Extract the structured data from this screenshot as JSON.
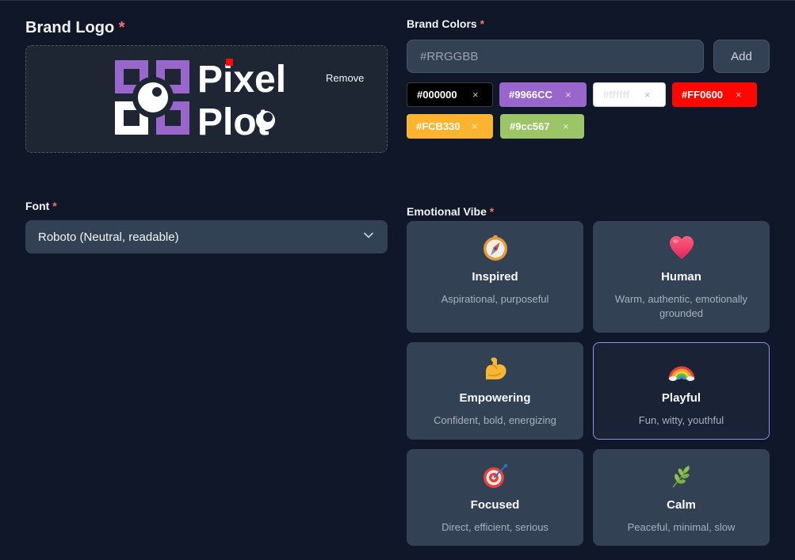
{
  "brand_logo": {
    "label": "Brand Logo",
    "required_mark": "*",
    "remove_label": "Remove",
    "logo_text_line1": "Pixel",
    "logo_text_line2": "Plot"
  },
  "brand_colors": {
    "label": "Brand Colors",
    "required_mark": "*",
    "input_placeholder": "#RRGGBB",
    "add_label": "Add",
    "remove_glyph": "×",
    "chips": [
      {
        "value": "#000000",
        "bg": "#000000",
        "fg": "#ffffff"
      },
      {
        "value": "#9966CC",
        "bg": "#9966cc",
        "fg": "#ffffff"
      },
      {
        "value": "#ffffff",
        "bg": "#ffffff",
        "fg": "#e8e8e8"
      },
      {
        "value": "#FF0600",
        "bg": "#ff0600",
        "fg": "#ffffff"
      },
      {
        "value": "#FCB330",
        "bg": "#fcb330",
        "fg": "#ffffff"
      },
      {
        "value": "#9cc567",
        "bg": "#9cc567",
        "fg": "#ffffff"
      }
    ]
  },
  "font": {
    "label": "Font",
    "required_mark": "*",
    "selected": "Roboto (Neutral, readable)"
  },
  "emotional_vibe": {
    "label": "Emotional Vibe",
    "required_mark": "*",
    "selected": "Playful",
    "options": [
      {
        "title": "Inspired",
        "desc": "Aspirational, purposeful",
        "icon": "compass-icon"
      },
      {
        "title": "Human",
        "desc": "Warm, authentic, emotionally grounded",
        "icon": "heart-icon"
      },
      {
        "title": "Empowering",
        "desc": "Confident, bold, energizing",
        "icon": "flexed-biceps-icon"
      },
      {
        "title": "Playful",
        "desc": "Fun, witty, youthful",
        "icon": "rainbow-icon"
      },
      {
        "title": "Focused",
        "desc": "Direct, efficient, serious",
        "icon": "bullseye-icon"
      },
      {
        "title": "Calm",
        "desc": "Peaceful, minimal, slow",
        "icon": "herb-icon"
      }
    ]
  }
}
